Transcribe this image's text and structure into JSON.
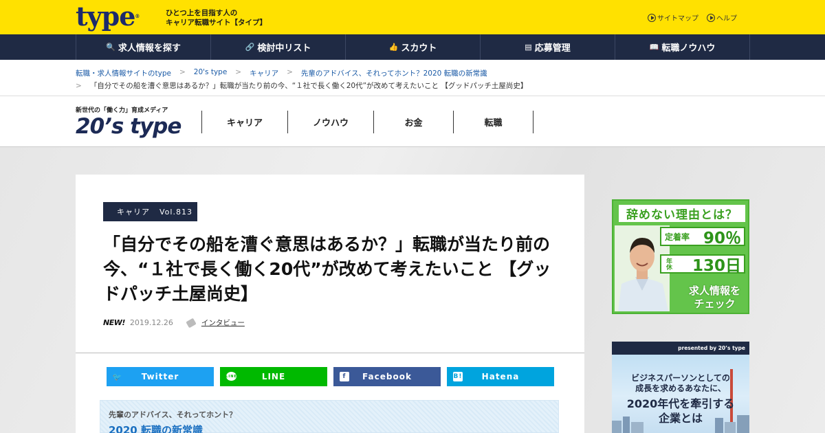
{
  "header": {
    "logo_text": "type",
    "logo_reg": "®",
    "tagline_line1": "ひとつ上を目指す人の",
    "tagline_line2": "キャリア転職サイト【タイプ】",
    "links": [
      {
        "label": "サイトマップ",
        "icon": "play-circle-icon"
      },
      {
        "label": "ヘルプ",
        "icon": "play-circle-icon"
      }
    ]
  },
  "nav": {
    "items": [
      {
        "label": "求人情報を探す",
        "icon": "🔍"
      },
      {
        "label": "検討中リスト",
        "icon": "🔗"
      },
      {
        "label": "スカウト",
        "icon": "👍"
      },
      {
        "label": "応募管理",
        "icon": "▤"
      },
      {
        "label": "転職ノウハウ",
        "icon": "📖"
      }
    ]
  },
  "breadcrumb": {
    "items": [
      "転職・求人情報サイトのtype",
      "20's type",
      "キャリア",
      "先輩のアドバイス、それってホント？2020 転職の新常識"
    ],
    "separator": ">",
    "current": "「自分でその船を漕ぐ意思はあるか？」転職が当たり前の今、“１社で長く働く20代”が改めて考えたいこと 【グッドパッチ土屋尚史】",
    "current_prefix": ">"
  },
  "site": {
    "sub": "新世代の「働く力」育成メディア",
    "logo": "20’s type",
    "categories": [
      "キャリア",
      "ノウハウ",
      "お金",
      "転職"
    ]
  },
  "article": {
    "category": "キャリア",
    "volume": "Vol.813",
    "title": "「自分でその船を漕ぐ意思はあるか？」転職が当たり前の今、“１社で長く働く20代”が改めて考えたいこと 【グッドパッチ土屋尚史】",
    "new_label": "NEW!",
    "date": "2019.12.26",
    "tag": "インタビュー"
  },
  "share": {
    "buttons": [
      {
        "label": "Twitter",
        "icon": "twitter-bird-icon",
        "glyph": "🐦",
        "color": "#1da1f2"
      },
      {
        "label": "LINE",
        "icon": "line-icon",
        "glyph": "LINE",
        "color": "#00b900"
      },
      {
        "label": "Facebook",
        "icon": "facebook-icon",
        "glyph": "f",
        "color": "#3b5998"
      },
      {
        "label": "Hatena",
        "icon": "hatena-icon",
        "glyph": "B!",
        "color": "#00a4de"
      }
    ]
  },
  "series": {
    "sub": "先輩のアドバイス、それってホント？",
    "title": "2020 転職の新常識"
  },
  "ads": {
    "ad1": {
      "headline": "辞めない理由とは？",
      "row1_label": "定着率",
      "row1_value": "90％",
      "row2_label": "年休",
      "row2_value": "130日",
      "cta_line1": "求人情報を",
      "cta_line2": "チェック"
    },
    "ad2": {
      "presented": "presented by 20’s type",
      "line1": "ビジネスパーソンとしての",
      "line2": "成長を求めるあなたに、",
      "line3": "2020年代を牽引する",
      "line4": "企業とは"
    }
  },
  "colors": {
    "brand_yellow": "#ffe100",
    "navy": "#1f2a44",
    "link_blue": "#1a5aa6"
  }
}
